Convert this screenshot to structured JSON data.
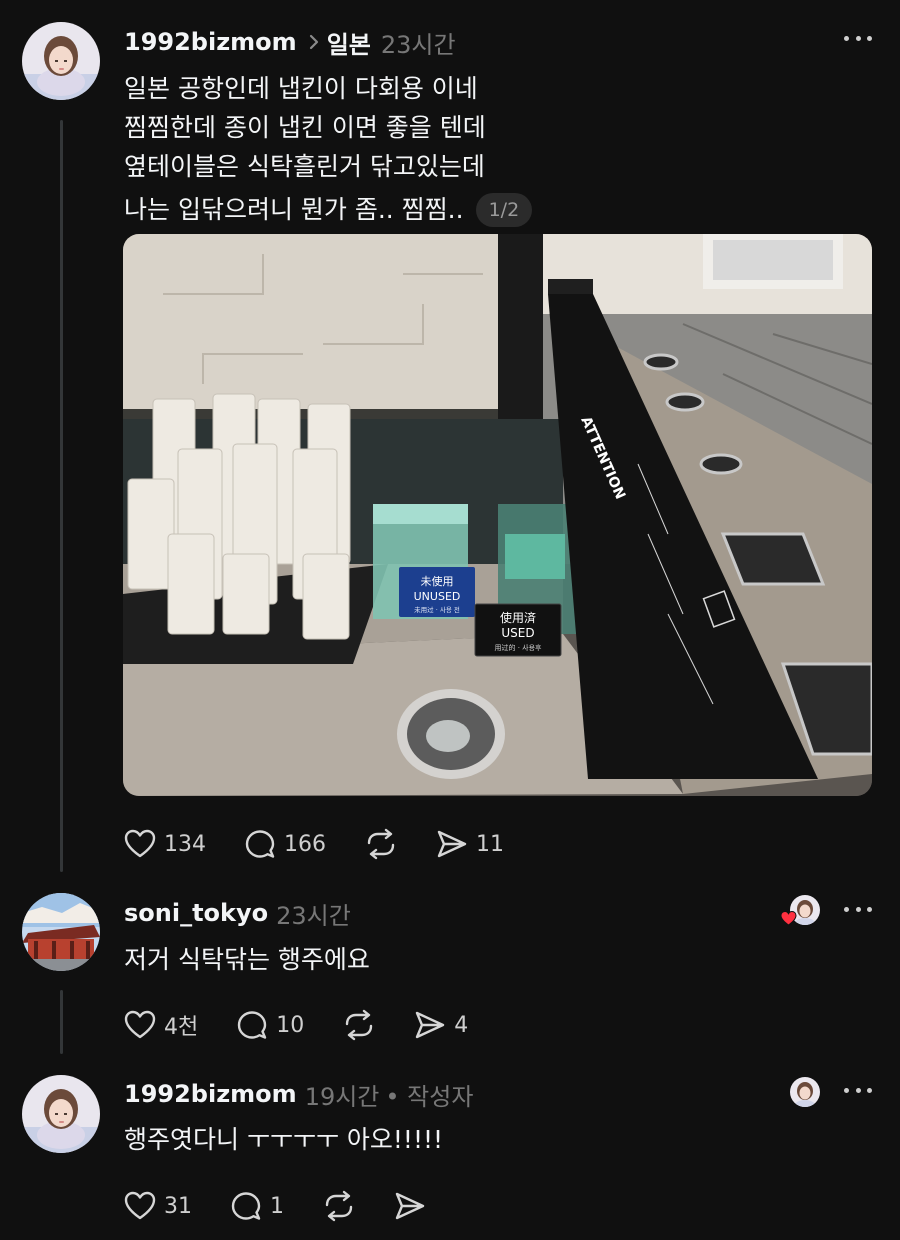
{
  "main_post": {
    "username": "1992bizmom",
    "topic": "일본",
    "time": "23시간",
    "lines": [
      "일본 공항인데 냅킨이 다회용 이네",
      "찜찜한데 종이 냅킨 이면 좋을 텐데",
      "옆테이블은 식탁흘린거 닦고있는데",
      "나는 입닦으려니 뭔가 좀.. 찜찜.."
    ],
    "page_indicator": "1/2",
    "photo": {
      "sign_unused_jp": "未使用",
      "sign_unused_en": "UNUSED",
      "sign_unused_sub": "未用过 · 사용 전",
      "sign_used_jp": "使用済",
      "sign_used_en": "USED",
      "sign_used_sub": "用过的 · 사용후",
      "bin_label": "ATTENTION"
    },
    "likes": "134",
    "comments": "166",
    "shares": "11"
  },
  "reply1": {
    "username": "soni_tokyo",
    "time": "23시간",
    "text": "저거 식탁닦는 행주에요",
    "likes": "4천",
    "comments": "10",
    "shares": "4"
  },
  "reply2": {
    "username": "1992bizmom",
    "time": "19시간",
    "author_tag": "• 작성자",
    "text": "행주엿다니 ㅜㅜㅜㅜ 아오!!!!!",
    "likes": "31",
    "comments": "1"
  },
  "icons": {
    "like": "heart-icon",
    "comment": "comment-bubble-icon",
    "repost": "repost-icon",
    "share": "send-icon",
    "more": "more-options-icon"
  },
  "colors": {
    "background": "#101010",
    "text": "#f3f5f7",
    "muted": "#777777",
    "heart_badge": "#ff3040"
  }
}
